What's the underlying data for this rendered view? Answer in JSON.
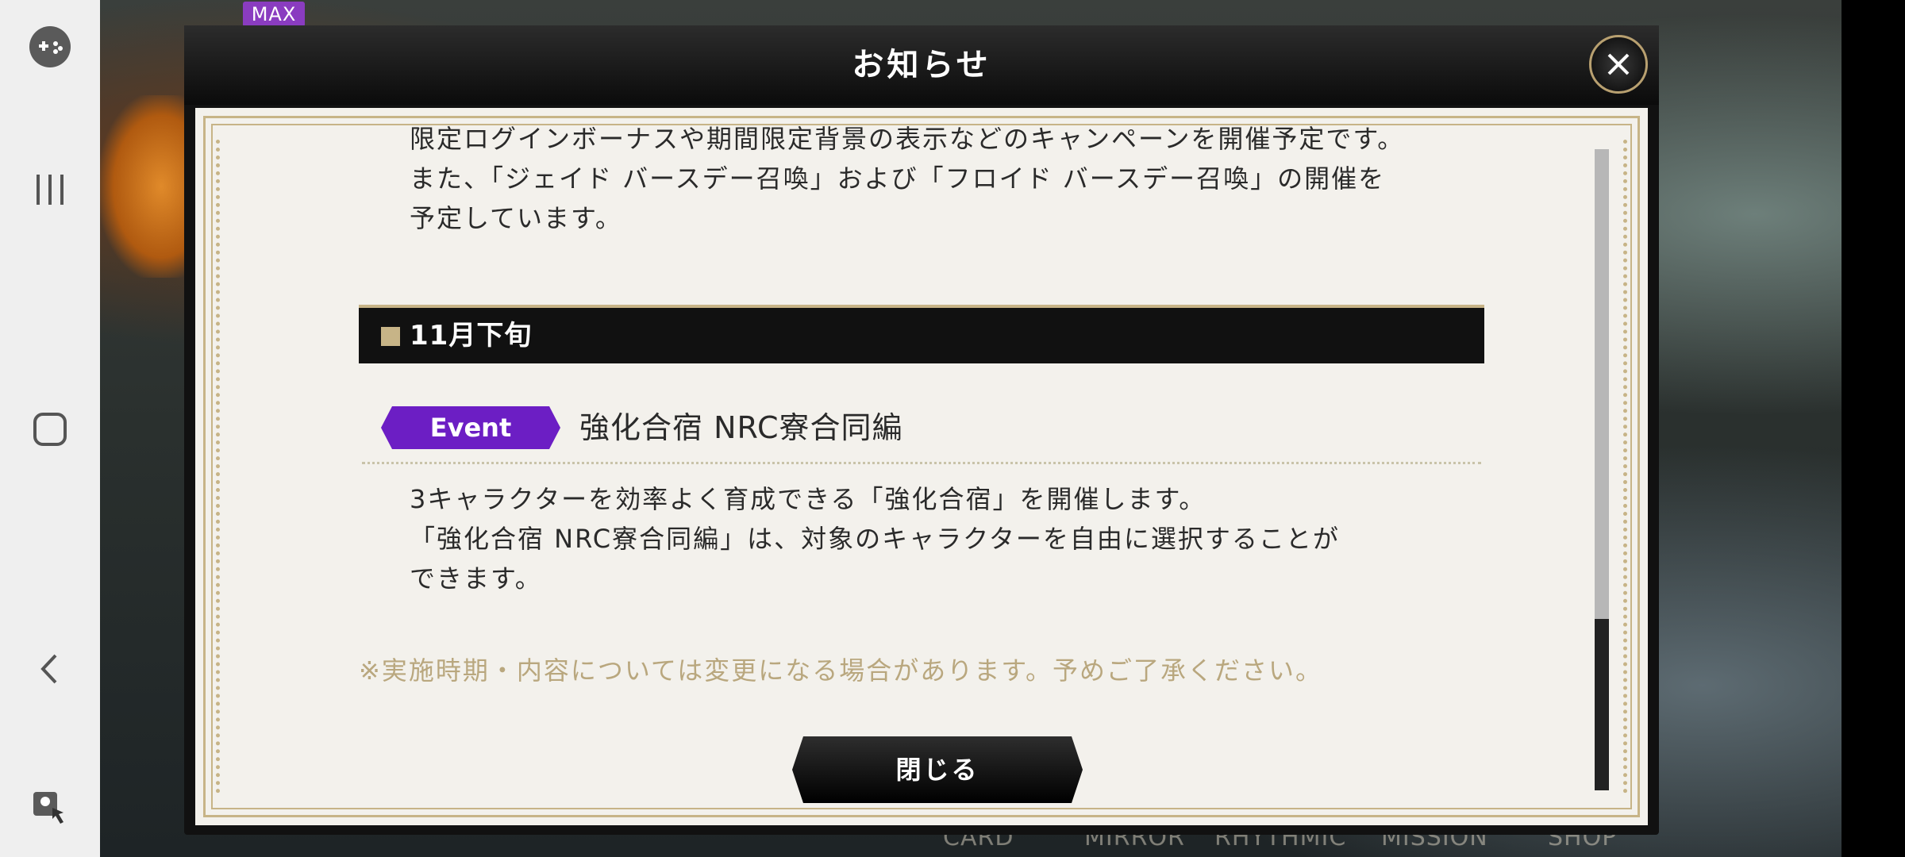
{
  "system_bar": {
    "icons": [
      "game-controller-icon",
      "recent-apps-icon",
      "home-icon",
      "back-icon",
      "touch-assist-icon"
    ]
  },
  "background": {
    "max_badge": "MAX",
    "bottom_tabs": [
      "CARD",
      "MIRROR",
      "RHYTHMIC",
      "MISSION",
      "SHOP"
    ]
  },
  "dialog": {
    "title": "お知らせ",
    "intro": [
      "限定ログインボーナスや期間限定背景の表示などのキャンペーンを開催予定です。",
      "また、「ジェイド バースデー召喚」および「フロイド バースデー召喚」の開催を",
      "予定しています。"
    ],
    "section_label": "11月下旬",
    "event_tag": "Event",
    "event_title": "強化合宿 NRC寮合同編",
    "event_body": [
      "3キャラクターを効率よく育成できる「強化合宿」を開催します。",
      "「強化合宿 NRC寮合同編」は、対象のキャラクターを自由に選択することが",
      "できます。"
    ],
    "notice": "※実施時期・内容については変更になる場合があります。予めご了承ください。",
    "close_button": "閉じる",
    "scroll_position": 0.72
  },
  "colors": {
    "accent_gold": "#c7b487",
    "event_purple": "#6c1ec4",
    "paper": "#f3f1ec"
  }
}
